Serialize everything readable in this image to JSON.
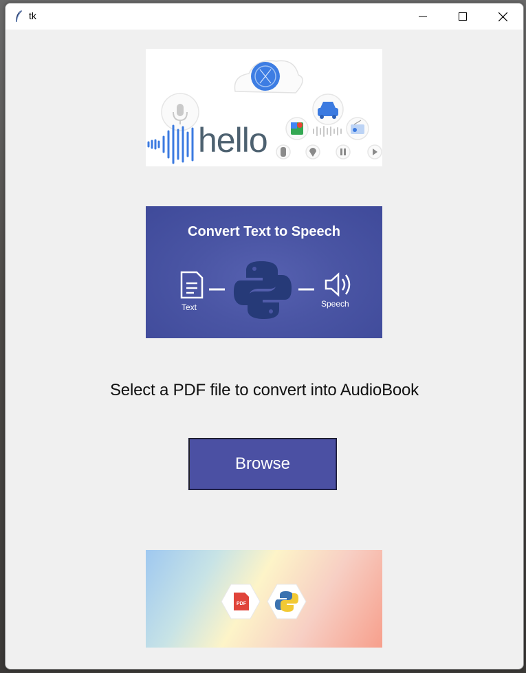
{
  "window": {
    "title": "tk",
    "icons": [
      "feather-icon",
      "minimize-icon",
      "maximize-icon",
      "close-icon"
    ]
  },
  "banner_hello": {
    "word": "hello",
    "icons": [
      "microphone-icon",
      "brain-chip-icon",
      "car-icon",
      "maps-icon",
      "radio-icon",
      "traffic-light-icon",
      "location-icon",
      "pause-icon",
      "play-icon"
    ]
  },
  "banner_tts": {
    "title": "Convert Text to Speech",
    "text_label": "Text",
    "speech_label": "Speech",
    "icons": [
      "document-icon",
      "python-logo-icon",
      "speaker-icon"
    ]
  },
  "prompt": "Select a PDF file to convert into AudioBook",
  "browse_button": {
    "label": "Browse"
  },
  "footer_image": {
    "pdf_badge": "PDF",
    "icons": [
      "pdf-file-icon",
      "python-logo-icon"
    ]
  },
  "colors": {
    "button_bg": "#4b50a3",
    "banner_bg": "#4a55a4",
    "window_bg": "#f0f0f0"
  }
}
